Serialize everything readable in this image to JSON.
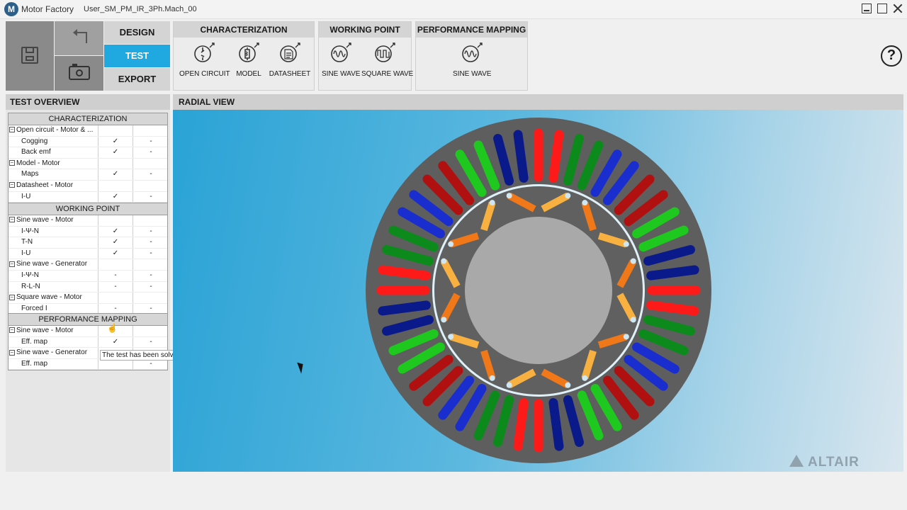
{
  "titlebar": {
    "app_logo": "M",
    "app_name": "Motor Factory",
    "document": "User_SM_PM_IR_3Ph.Mach_00"
  },
  "modes": {
    "design": "DESIGN",
    "test": "TEST",
    "export": "EXPORT"
  },
  "ribbon": {
    "characterization": {
      "title": "CHARACTERIZATION",
      "tools": [
        "OPEN CIRCUIT",
        "MODEL",
        "DATASHEET"
      ]
    },
    "working_point": {
      "title": "WORKING POINT",
      "tools": [
        "SINE WAVE",
        "SQUARE WAVE"
      ]
    },
    "performance_mapping": {
      "title": "PERFORMANCE MAPPING",
      "tools": [
        "SINE WAVE"
      ]
    },
    "help": "?"
  },
  "test_overview": {
    "title": "TEST OVERVIEW",
    "characterization": {
      "title": "CHARACTERIZATION",
      "rows": [
        {
          "name": "Open circuit - Motor & ...",
          "group": true,
          "c1": "",
          "c2": ""
        },
        {
          "name": "Cogging",
          "group": false,
          "c1": "✓",
          "c2": "-"
        },
        {
          "name": "Back emf",
          "group": false,
          "c1": "✓",
          "c2": "-"
        },
        {
          "name": "Model - Motor",
          "group": true,
          "c1": "",
          "c2": ""
        },
        {
          "name": "Maps",
          "group": false,
          "c1": "✓",
          "c2": "-"
        },
        {
          "name": "Datasheet - Motor",
          "group": true,
          "c1": "",
          "c2": ""
        },
        {
          "name": "I-U",
          "group": false,
          "c1": "✓",
          "c2": "-"
        }
      ]
    },
    "working_point": {
      "title": "WORKING POINT",
      "rows": [
        {
          "name": "Sine wave - Motor",
          "group": true,
          "c1": "",
          "c2": ""
        },
        {
          "name": "I-Ψ-N",
          "group": false,
          "c1": "✓",
          "c2": "-"
        },
        {
          "name": "T-N",
          "group": false,
          "c1": "✓",
          "c2": "-"
        },
        {
          "name": "I-U",
          "group": false,
          "c1": "✓",
          "c2": "-"
        },
        {
          "name": "Sine wave - Generator",
          "group": true,
          "c1": "",
          "c2": ""
        },
        {
          "name": "I-Ψ-N",
          "group": false,
          "c1": "-",
          "c2": "-"
        },
        {
          "name": "R-L-N",
          "group": false,
          "c1": "-",
          "c2": "-"
        },
        {
          "name": "Square wave - Motor",
          "group": true,
          "c1": "",
          "c2": ""
        },
        {
          "name": "Forced I",
          "group": false,
          "c1": "-",
          "c2": "-"
        }
      ]
    },
    "performance_mapping": {
      "title": "PERFORMANCE MAPPING",
      "rows": [
        {
          "name": "Sine wave - Motor",
          "group": true,
          "c1": "",
          "c2": ""
        },
        {
          "name": "Eff. map",
          "group": false,
          "c1": "✓",
          "c2": "-"
        },
        {
          "name": "Sine wave - Generator",
          "group": true,
          "c1": "",
          "c2": ""
        },
        {
          "name": "Eff. map",
          "group": false,
          "c1": "",
          "c2": "-"
        }
      ]
    },
    "tooltip": "The test has been solved",
    "group_box_symbol": "⊟"
  },
  "radial_view": {
    "title": "RADIAL VIEW",
    "brand": "ALTAIR",
    "slots": 48,
    "poles": 8,
    "colors": {
      "stator": "#5e5e5e",
      "rotor": "#606060",
      "shaft": "#a9a9a9",
      "airgap": "#dff0f8",
      "magnet_light": "#f8b040",
      "magnet_dark": "#f07818",
      "phase_a": "#ff1a1a",
      "phase_a_return": "#b01010",
      "phase_b": "#1a2ecf",
      "phase_b_return": "#0a1a8a",
      "phase_c": "#1ec81e",
      "phase_c_return": "#0c8a1c"
    }
  }
}
